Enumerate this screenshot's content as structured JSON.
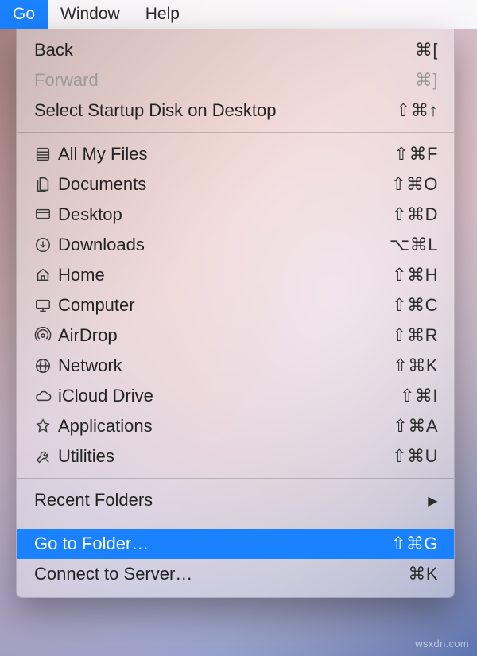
{
  "menubar": {
    "items": [
      {
        "label": "Go",
        "active": true
      },
      {
        "label": "Window",
        "active": false
      },
      {
        "label": "Help",
        "active": false
      }
    ]
  },
  "menu": {
    "back": {
      "label": "Back",
      "shortcut": "⌘["
    },
    "forward": {
      "label": "Forward",
      "shortcut": "⌘]"
    },
    "startup": {
      "label": "Select Startup Disk on Desktop",
      "shortcut": "⇧⌘↑"
    },
    "allmyfiles": {
      "label": "All My Files",
      "shortcut": "⇧⌘F"
    },
    "documents": {
      "label": "Documents",
      "shortcut": "⇧⌘O"
    },
    "desktop": {
      "label": "Desktop",
      "shortcut": "⇧⌘D"
    },
    "downloads": {
      "label": "Downloads",
      "shortcut": "⌥⌘L"
    },
    "home": {
      "label": "Home",
      "shortcut": "⇧⌘H"
    },
    "computer": {
      "label": "Computer",
      "shortcut": "⇧⌘C"
    },
    "airdrop": {
      "label": "AirDrop",
      "shortcut": "⇧⌘R"
    },
    "network": {
      "label": "Network",
      "shortcut": "⇧⌘K"
    },
    "icloud": {
      "label": "iCloud Drive",
      "shortcut": "⇧⌘I"
    },
    "apps": {
      "label": "Applications",
      "shortcut": "⇧⌘A"
    },
    "utilities": {
      "label": "Utilities",
      "shortcut": "⇧⌘U"
    },
    "recent": {
      "label": "Recent Folders",
      "shortcut": "▶"
    },
    "gotofolder": {
      "label": "Go to Folder…",
      "shortcut": "⇧⌘G"
    },
    "connect": {
      "label": "Connect to Server…",
      "shortcut": "⌘K"
    }
  },
  "watermark": "wsxdn.com"
}
